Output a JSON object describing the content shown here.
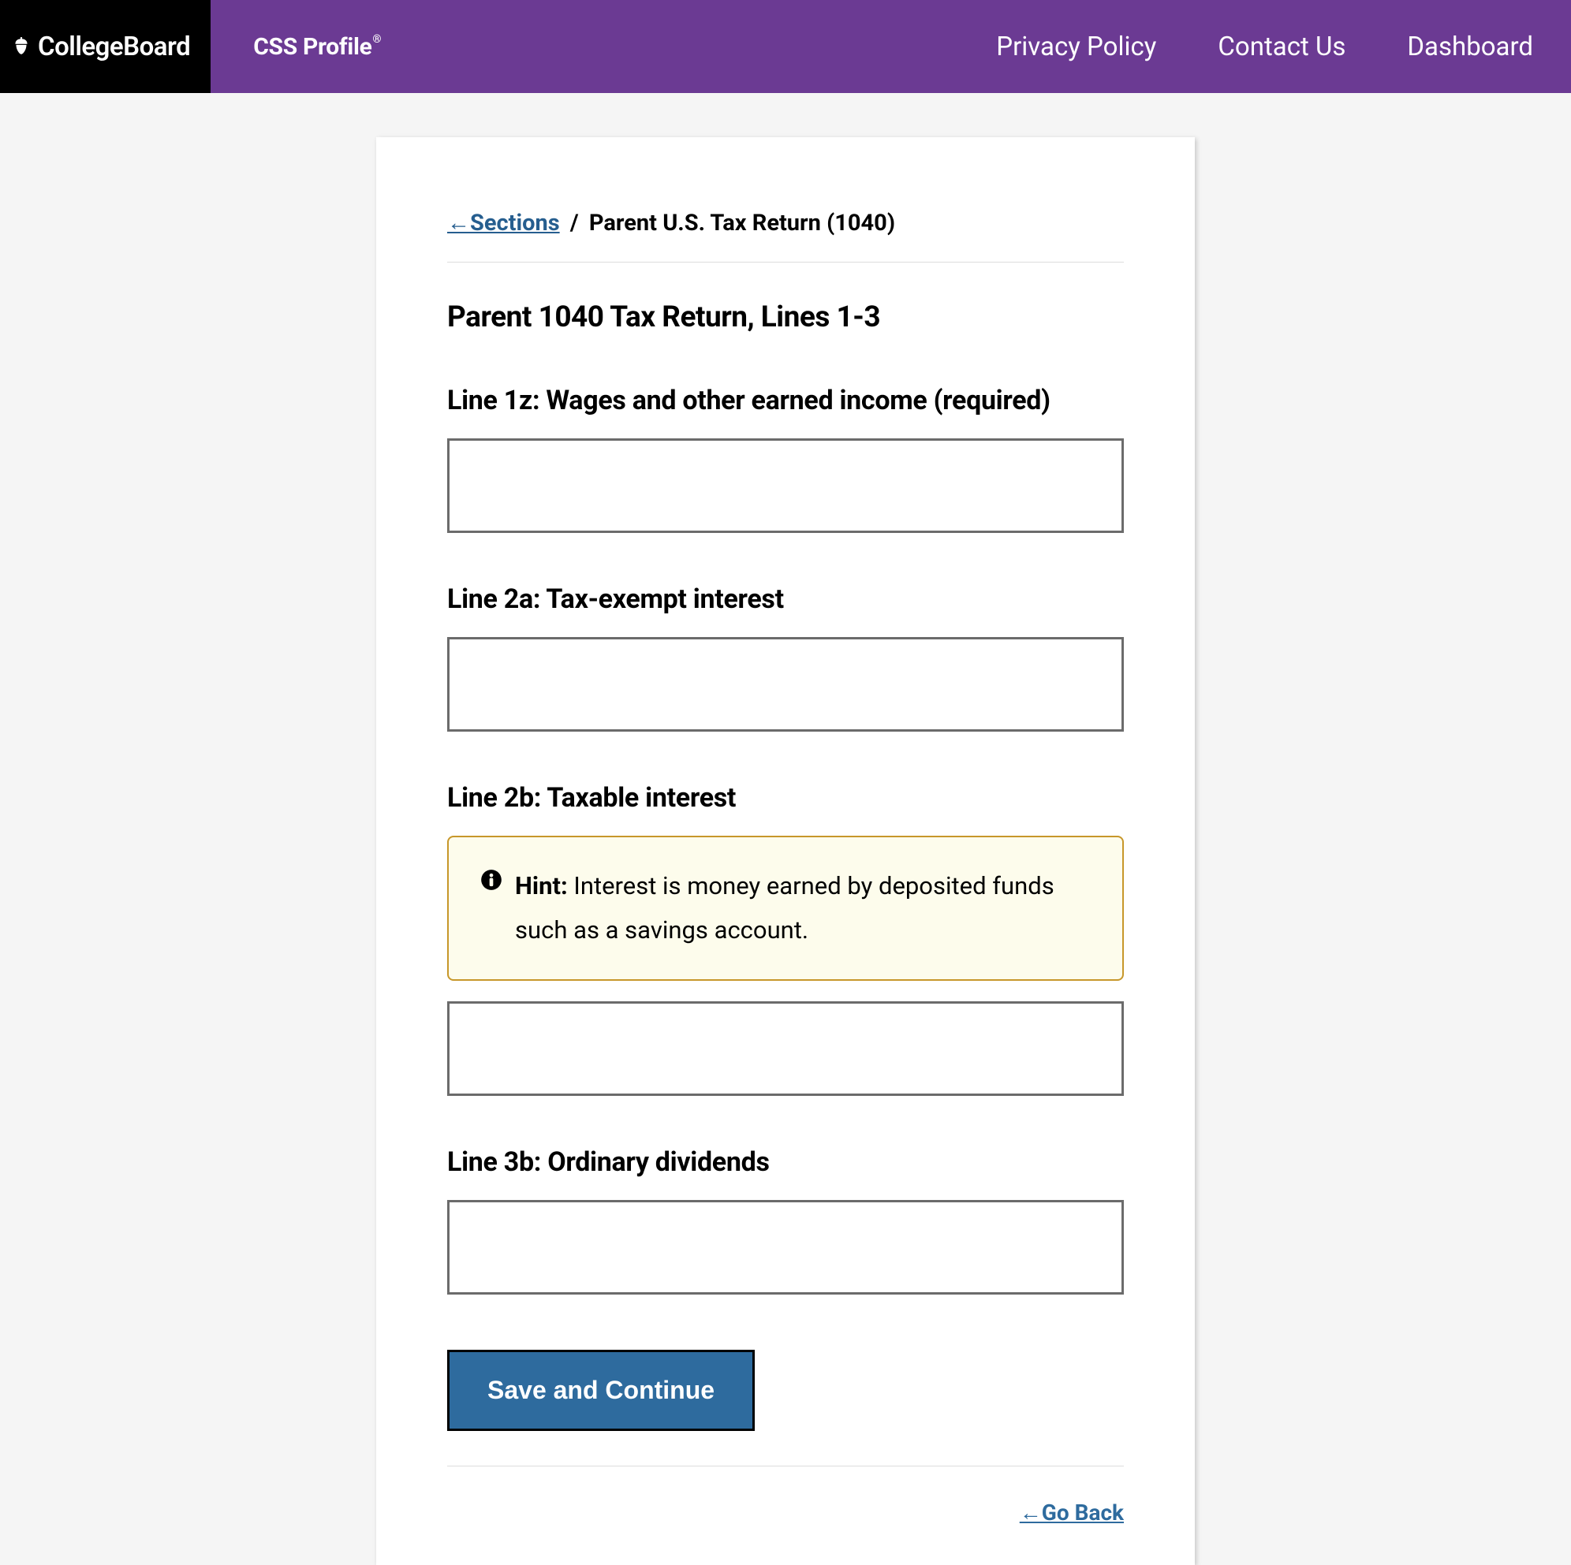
{
  "header": {
    "collegeboard": "CollegeBoard",
    "css_profile": "CSS Profile",
    "nav": {
      "privacy": "Privacy Policy",
      "contact": "Contact Us",
      "dashboard": "Dashboard"
    }
  },
  "breadcrumb": {
    "sections_link": "←Sections",
    "separator": "/",
    "current": "Parent U.S. Tax Return (1040)"
  },
  "page_title": "Parent 1040 Tax Return, Lines 1-3",
  "fields": {
    "line1z": {
      "label": "Line 1z: Wages and other earned income (required)",
      "value": ""
    },
    "line2a": {
      "label": "Line 2a: Tax-exempt interest",
      "value": ""
    },
    "line2b": {
      "label": "Line 2b: Taxable interest",
      "value": "",
      "hint_label": "Hint:",
      "hint_text": "Interest is money earned by deposited funds such as a savings account."
    },
    "line3b": {
      "label": "Line 3b: Ordinary dividends",
      "value": ""
    }
  },
  "buttons": {
    "save": "Save and Continue",
    "go_back": "←Go Back"
  }
}
